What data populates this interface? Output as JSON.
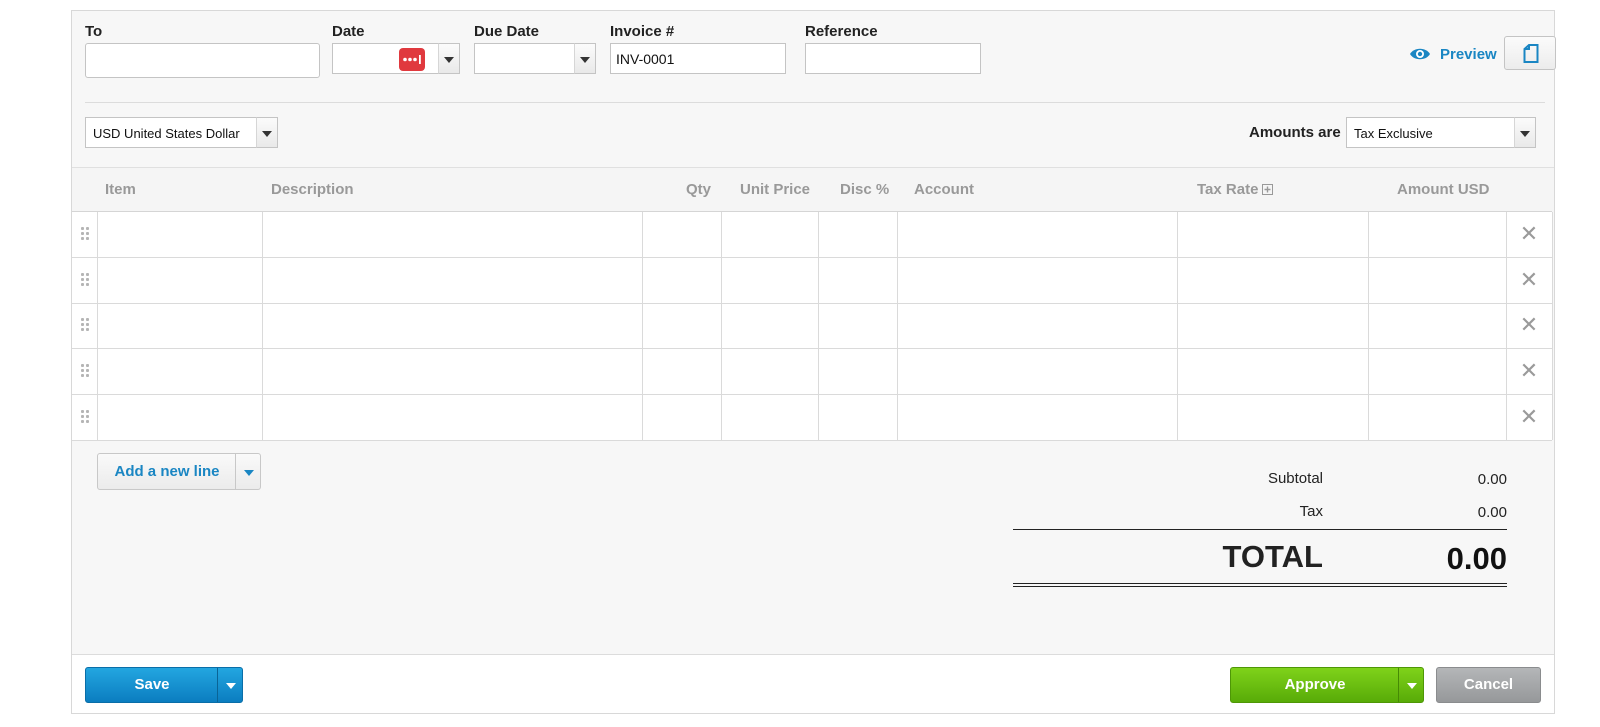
{
  "header": {
    "to_label": "To",
    "to_value": "",
    "date_label": "Date",
    "date_value": "",
    "due_date_label": "Due Date",
    "due_date_value": "",
    "invoice_label": "Invoice #",
    "invoice_value": "INV-0001",
    "reference_label": "Reference",
    "reference_value": "",
    "preview_label": "Preview"
  },
  "currency": {
    "selected": "USD United States Dollar"
  },
  "amounts": {
    "label": "Amounts are",
    "selected": "Tax Exclusive"
  },
  "grid": {
    "columns": [
      "Item",
      "Description",
      "Qty",
      "Unit Price",
      "Disc %",
      "Account",
      "Tax Rate",
      "Amount USD"
    ],
    "row_count": 5,
    "remove_glyph": "✕"
  },
  "add_line": {
    "label": "Add a new line"
  },
  "totals": {
    "subtotal_label": "Subtotal",
    "subtotal_value": "0.00",
    "tax_label": "Tax",
    "tax_value": "0.00",
    "total_label": "TOTAL",
    "total_value": "0.00"
  },
  "footer": {
    "save_label": "Save",
    "approve_label": "Approve",
    "cancel_label": "Cancel"
  },
  "colors": {
    "accent": "#1a86c3",
    "approve": "#6bbf12",
    "save": "#148fd0",
    "password_icon": "#e0393e"
  },
  "icons": [
    "eye-icon",
    "document-icon",
    "password-manager-icon",
    "plus-box-icon",
    "drag-handle-icon",
    "close-icon",
    "chevron-down-icon"
  ]
}
